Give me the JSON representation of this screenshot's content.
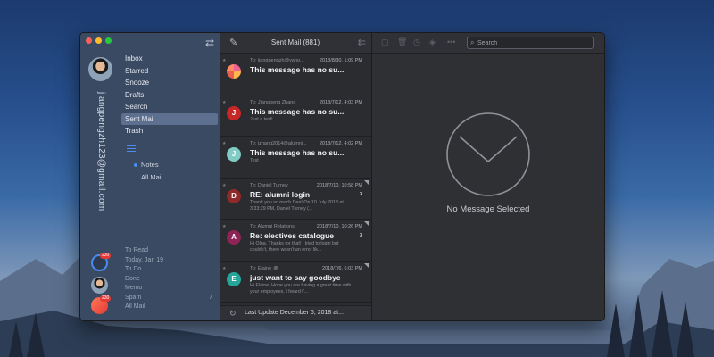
{
  "sidebar": {
    "account_email": "jiangpengzh123@gmail.com",
    "folders": [
      "Inbox",
      "Starred",
      "Snooze",
      "Drafts",
      "Search",
      "Sent Mail",
      "Trash"
    ],
    "active_folder": "Sent Mail",
    "sub_folders": [
      "Notes",
      "All Mail"
    ],
    "smart_folders": [
      {
        "label": "To Read",
        "count": ""
      },
      {
        "label": "Today, Jan 19",
        "count": ""
      },
      {
        "label": "To Do",
        "count": ""
      },
      {
        "label": "Done",
        "count": ""
      },
      {
        "label": "Memo",
        "count": ""
      },
      {
        "label": "Spam",
        "count": "7"
      },
      {
        "label": "All Mail",
        "count": ""
      }
    ],
    "bottom_badges": [
      "230",
      "230"
    ]
  },
  "message_list": {
    "title": "Sent Mail (881)",
    "messages": [
      {
        "to": "To: jiangpengzh@yaho...",
        "date": "2018/8/30, 1:09 PM",
        "subject": "This message has no su...",
        "preview": "",
        "initial": "",
        "thread_count": "",
        "avatar_color": "#e8614e"
      },
      {
        "to": "To: Jiangpeng Zhang",
        "date": "2018/7/12, 4:03 PM",
        "subject": "This message has no su...",
        "preview": "Just a test!",
        "initial": "J",
        "thread_count": "",
        "avatar_color": "#c62828"
      },
      {
        "to": "To: jzhang2014@alumni...",
        "date": "2018/7/12, 4:02 PM",
        "subject": "This message has no su...",
        "preview": "Test",
        "initial": "J",
        "thread_count": "",
        "avatar_color": "#80cbc4"
      },
      {
        "to": "To: Daniel Turney",
        "date": "2018/7/10, 10:58 PM",
        "subject": "RE: alumni login",
        "preview": "Thank you so much Dan! On 10 July 2018 at 3:33:29 PM, Daniel Turney (...",
        "initial": "D",
        "thread_count": "3",
        "avatar_color": "#8e2a2a"
      },
      {
        "to": "To: Alumni Relations",
        "date": "2018/7/10, 10:26 PM",
        "subject": "Re: electives catalogue",
        "preview": "Hi Olga, Thanks for that! I tried to login but couldn't, there wasn't an error lik...",
        "initial": "A",
        "thread_count": "3",
        "avatar_color": "#8e2456"
      },
      {
        "to": "To: Elaine",
        "date": "2018/7/6, 6:03 PM",
        "subject": "just want to say goodbye",
        "preview": "Hi Elaine, Hope you are having a great time with your employees. I heard t'...",
        "initial": "E",
        "thread_count": "",
        "avatar_color": "#26a69a"
      }
    ],
    "footer_status": "Last Update  December 6, 2018 at..."
  },
  "reader": {
    "search_placeholder": "Search",
    "empty_text": "No Message Selected"
  },
  "colors": {
    "sidebar_bg": "#3a4a63",
    "active_folder_bg": "#5d7090",
    "accent": "#4a8cf0",
    "badge": "#e53935"
  }
}
